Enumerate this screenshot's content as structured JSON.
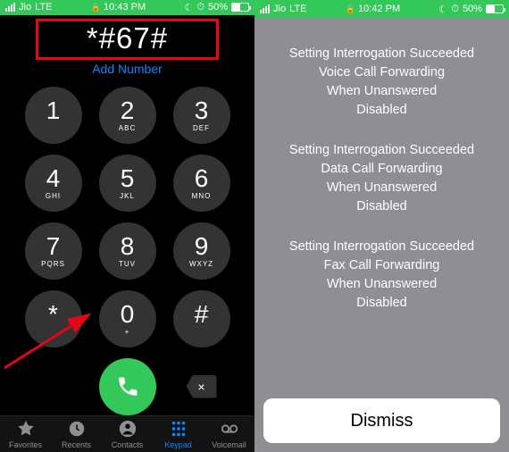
{
  "status": {
    "carrier": "Jio",
    "network": "LTE",
    "time_left": "10:43 PM",
    "time_right": "10:42 PM",
    "moon_icon": "moon-icon",
    "alarm_icon": "alarm-icon",
    "battery_pct": "50%"
  },
  "dialer": {
    "input": "*#67#",
    "add_number": "Add Number",
    "keys": [
      {
        "digit": "1",
        "letters": ""
      },
      {
        "digit": "2",
        "letters": "ABC"
      },
      {
        "digit": "3",
        "letters": "DEF"
      },
      {
        "digit": "4",
        "letters": "GHI"
      },
      {
        "digit": "5",
        "letters": "JKL"
      },
      {
        "digit": "6",
        "letters": "MNO"
      },
      {
        "digit": "7",
        "letters": "PQRS"
      },
      {
        "digit": "8",
        "letters": "TUV"
      },
      {
        "digit": "9",
        "letters": "WXYZ"
      },
      {
        "digit": "*",
        "letters": ""
      },
      {
        "digit": "0",
        "letters": "+"
      },
      {
        "digit": "#",
        "letters": ""
      }
    ],
    "delete_glyph": "×"
  },
  "tabs": {
    "favorites": "Favorites",
    "recents": "Recents",
    "contacts": "Contacts",
    "keypad": "Keypad",
    "voicemail": "Voicemail"
  },
  "alert": {
    "blocks": [
      [
        "Setting Interrogation Succeeded",
        "Voice Call Forwarding",
        "When Unanswered",
        "Disabled"
      ],
      [
        "Setting Interrogation Succeeded",
        "Data Call Forwarding",
        "When Unanswered",
        "Disabled"
      ],
      [
        "Setting Interrogation Succeeded",
        "Fax Call Forwarding",
        "When Unanswered",
        "Disabled"
      ]
    ],
    "dismiss": "Dismiss"
  }
}
